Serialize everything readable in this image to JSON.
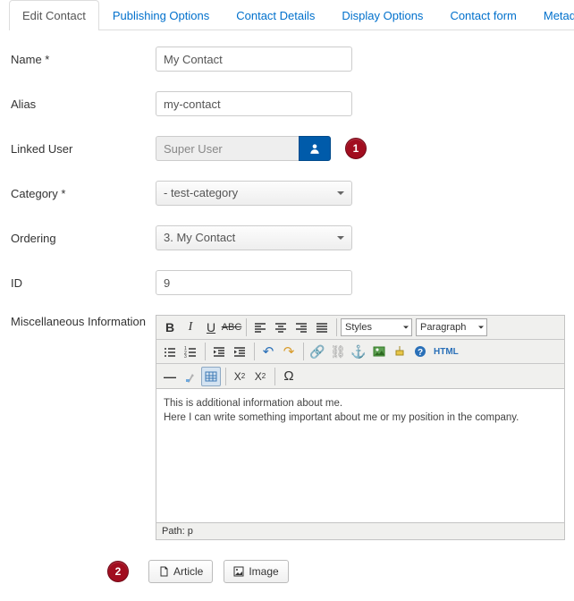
{
  "tabs": [
    {
      "label": "Edit Contact",
      "active": true
    },
    {
      "label": "Publishing Options",
      "active": false
    },
    {
      "label": "Contact Details",
      "active": false
    },
    {
      "label": "Display Options",
      "active": false
    },
    {
      "label": "Contact form",
      "active": false
    },
    {
      "label": "Metada",
      "active": false
    }
  ],
  "form": {
    "name": {
      "label": "Name *",
      "value": "My Contact"
    },
    "alias": {
      "label": "Alias",
      "value": "my-contact"
    },
    "linked_user": {
      "label": "Linked User",
      "value": "Super User"
    },
    "category": {
      "label": "Category *",
      "value": "- test-category"
    },
    "ordering": {
      "label": "Ordering",
      "value": "3. My Contact"
    },
    "id": {
      "label": "ID",
      "value": "9"
    },
    "misc": {
      "label": "Miscellaneous Information"
    }
  },
  "editor": {
    "styles_select": "Styles",
    "paragraph_select": "Paragraph",
    "content_line1": "This is additional information about me.",
    "content_line2": "Here I can write something important about me or my position in the company.",
    "path_label": "Path: p",
    "html_btn": "HTML"
  },
  "callouts": {
    "c1": "1",
    "c2": "2"
  },
  "bottom_buttons": {
    "article": "Article",
    "image": "Image"
  }
}
